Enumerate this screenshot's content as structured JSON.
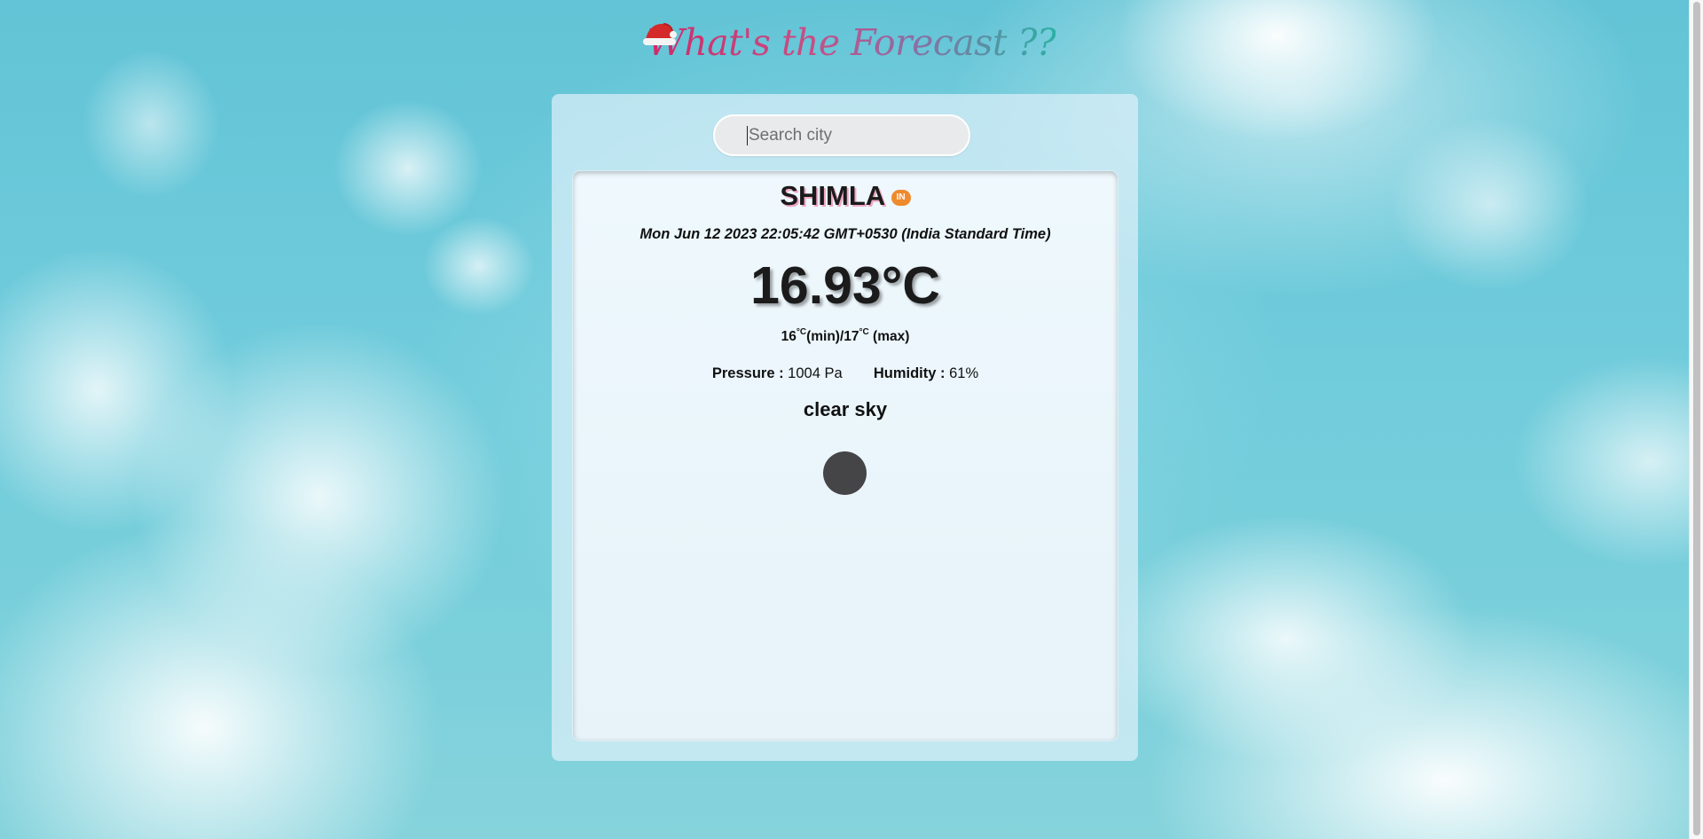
{
  "header": {
    "title": "What's the Forecast ??",
    "hat_icon": "santa-hat-icon"
  },
  "search": {
    "placeholder": "Search city",
    "value": ""
  },
  "weather": {
    "city": "SHIMLA",
    "country_code": "IN",
    "datetime": "Mon Jun 12 2023 22:05:42 GMT+0530 (India Standard Time)",
    "temperature": "16.93°C",
    "min_value": "16",
    "min_unit": "°C",
    "min_suffix": "(min)/",
    "max_value": "17",
    "max_unit": "°C",
    "max_suffix": " (max)",
    "pressure_label": "Pressure :",
    "pressure_value": "1004 Pa",
    "humidity_label": "Humidity :",
    "humidity_value": "61%",
    "description": "clear sky",
    "icon": "loading-dot-icon"
  },
  "colors": {
    "title_start": "#cf2968",
    "title_end": "#2bb0a4",
    "country_badge": "#ef8a2d",
    "loader": "#454548"
  }
}
